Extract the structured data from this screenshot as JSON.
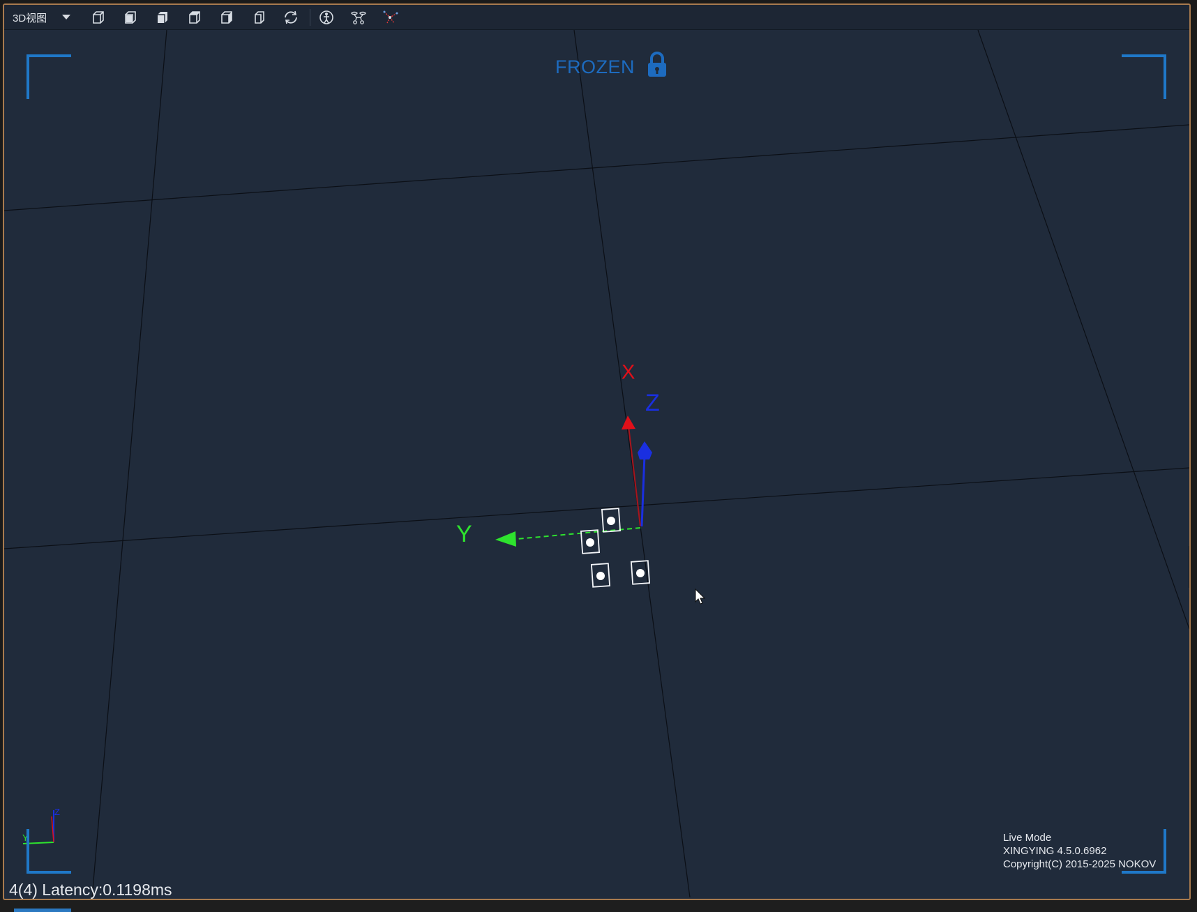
{
  "toolbar": {
    "view_label": "3D视图",
    "buttons": [
      {
        "name": "view-perspective-icon"
      },
      {
        "name": "view-front-icon"
      },
      {
        "name": "view-back-icon"
      },
      {
        "name": "view-left-icon"
      },
      {
        "name": "view-right-icon"
      },
      {
        "name": "view-top-icon"
      },
      {
        "name": "reset-view-icon"
      },
      {
        "name": "skeleton-icon"
      },
      {
        "name": "drone-icon"
      },
      {
        "name": "marker-trace-icon"
      }
    ]
  },
  "overlay": {
    "frozen_label": "FROZEN",
    "status": "4(4) Latency:0.1198ms",
    "mode": "Live Mode",
    "version": "XINGYING 4.5.0.6962",
    "copyright": "Copyright(C) 2015-2025 NOKOV"
  },
  "axes": {
    "x_label": "X",
    "y_label": "Y",
    "z_label": "Z",
    "x_color": "#e0101a",
    "y_color": "#2ee32e",
    "z_color": "#1a2fe0"
  },
  "mini_axes": {
    "y_label": "Y",
    "z_label": "Z"
  },
  "colors": {
    "background": "#202b3b",
    "accent": "#1f78c8",
    "frame_border": "#a87a4e"
  },
  "markers": {
    "count": 4
  }
}
